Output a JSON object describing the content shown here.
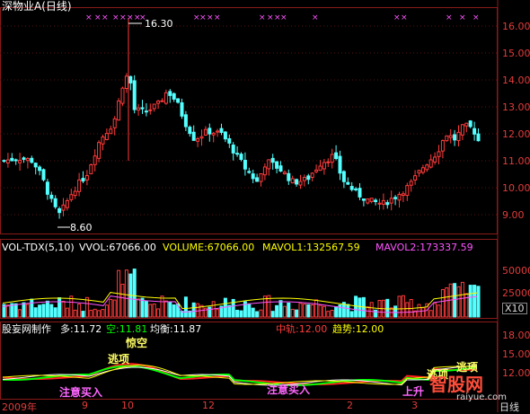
{
  "window": {
    "title": "深物业A(日线)"
  },
  "price_panel": {
    "high_label": "16.30",
    "low_label": "8.60",
    "y_ticks": [
      "16.00",
      "15.00",
      "14.00",
      "13.00",
      "12.00",
      "11.00",
      "10.00",
      "9.00"
    ]
  },
  "volume_panel": {
    "indicator": "VOL-TDX(5,10)",
    "vvol": "VVOL:67066.00",
    "volume": "VOLUME:67066.00",
    "mavol1": "MAVOL1:132567.59",
    "mavol2": "MAVOL2:173337.59",
    "y_ticks": [
      "50000",
      "25000"
    ],
    "unit": "X10"
  },
  "indicator_panel": {
    "name": "股妄网制作",
    "duo": "多:11.72",
    "kong": "空:11.81",
    "junheng": "均衡:11.87",
    "zhongju": "中轨:12.00",
    "qushi": "趋势:12.00",
    "y_ticks": [
      "18.00",
      "15.00",
      "12.00"
    ],
    "signals": {
      "jingkong": "惊空",
      "taoxiang_a": "逃项",
      "taoxiang_b": "逃项",
      "taoxiang_c": "逃项",
      "zhuyi_mairu_a": "注意买入",
      "zhuyi_mairu_b": "注意买入",
      "shangsheng": "上升"
    }
  },
  "x_axis": {
    "labels": [
      "2009年",
      "9",
      "10",
      "12",
      "2",
      "3"
    ],
    "period": "日线"
  },
  "watermark": {
    "brand": "智股网",
    "url": "raiyue.com"
  },
  "colors": {
    "up": "#ff3b3b",
    "down": "#54ffff",
    "ma_white": "#ffffff",
    "ma_yellow": "#ffff00",
    "ma_magenta": "#ff55ff",
    "ma_green": "#00ff00",
    "grid": "#8b1a1a"
  }
}
